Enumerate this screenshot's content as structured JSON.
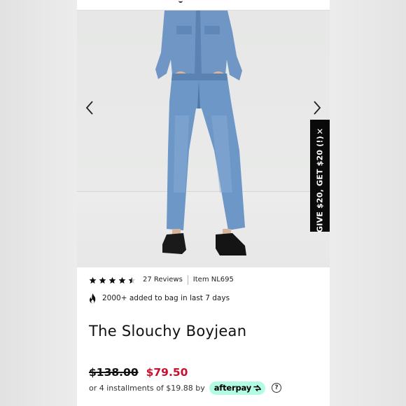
{
  "product": {
    "title": "The Slouchy Boyjean",
    "rating": 4.5,
    "rating_max": 5,
    "reviews_label": "27 Reviews",
    "item_number": "Item NL695",
    "bag_activity": "2000+ added to bag in last 7 days"
  },
  "gallery": {
    "image_alt": "Model wearing denim shirt and light-wash slouchy boyfriend jeans with black loafers",
    "prev_icon": "chevron-left-icon",
    "next_icon": "chevron-right-icon"
  },
  "promo": {
    "text": "GIVE $20, GET $20 (!)",
    "close_symbol": "✕"
  },
  "pricing": {
    "original_price": "$138.00",
    "sale_price": "$79.50",
    "sale_color": "#c8102e",
    "installments_text": "or 4 installments of $19.88 by",
    "afterpay_label": "afterpay",
    "afterpay_color": "#b2fce4",
    "help_symbol": "?"
  }
}
